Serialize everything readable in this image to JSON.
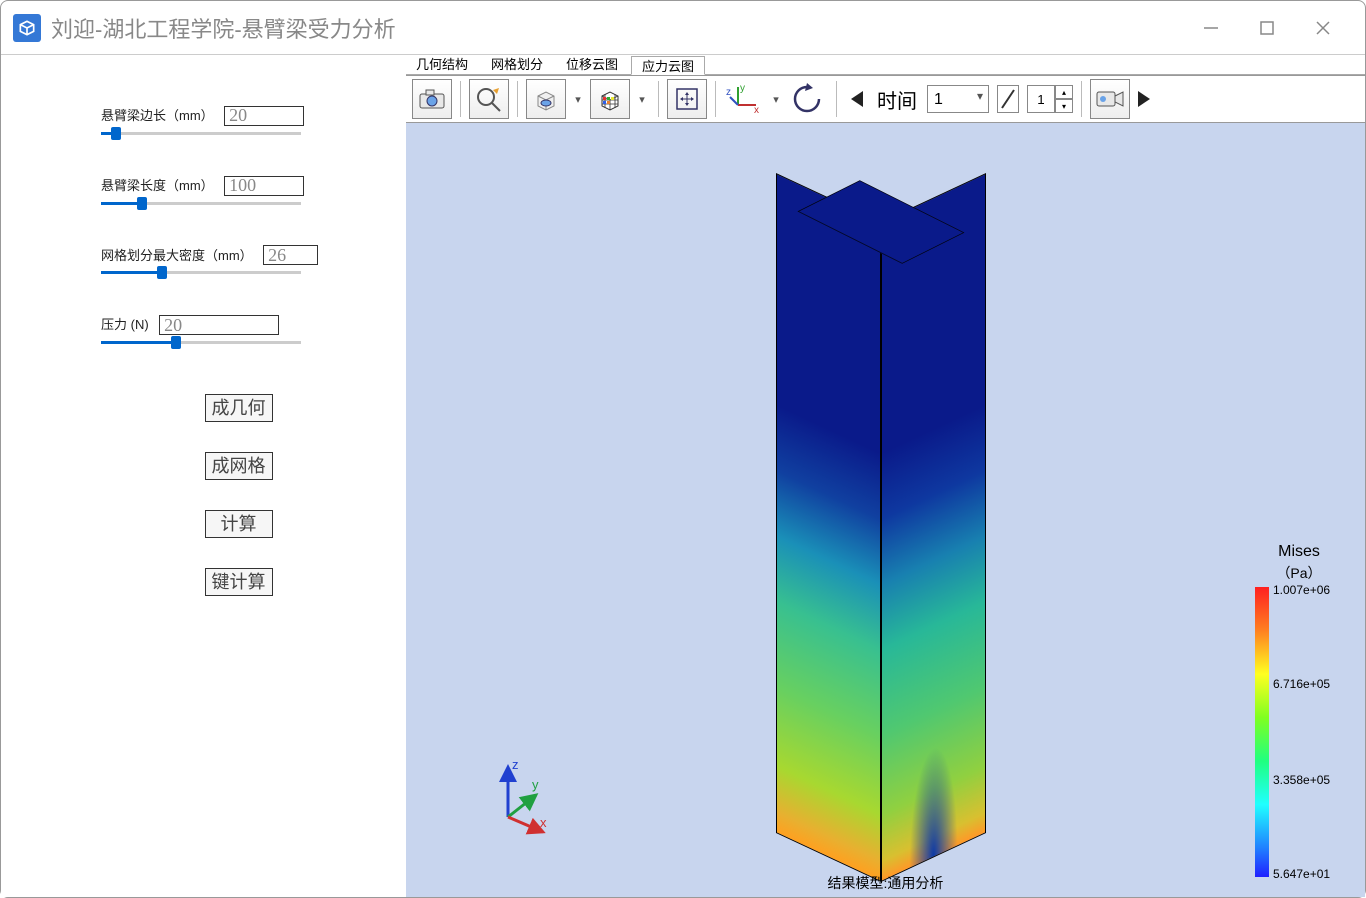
{
  "window": {
    "title": "刘迎-湖北工程学院-悬臂梁受力分析"
  },
  "sidebar": {
    "params": [
      {
        "label": "悬臂梁边长（mm）",
        "value": "20",
        "slider_pct": 5
      },
      {
        "label": "悬臂梁长度（mm）",
        "value": "100",
        "slider_pct": 18
      },
      {
        "label": "网格划分最大密度（mm）",
        "value": "26",
        "slider_pct": 28
      },
      {
        "label": "压力 (N)",
        "value": "20",
        "slider_pct": 35
      }
    ],
    "buttons": [
      "成几何",
      "成网格",
      "计算",
      "键计算"
    ]
  },
  "tabs": {
    "items": [
      "几何结构",
      "网格划分",
      "位移云图",
      "应力云图"
    ],
    "active_index": 3
  },
  "toolbar": {
    "time_label": "时间",
    "time_value": "1",
    "frame_value": "1"
  },
  "viewport": {
    "result_label": "结果模型:通用分析",
    "axes": {
      "x": "x",
      "y": "y",
      "z": "z"
    }
  },
  "legend": {
    "title": "Mises",
    "unit": "（Pa）",
    "ticks": [
      {
        "pos": 0,
        "label": "1.007e+06"
      },
      {
        "pos": 33,
        "label": "6.716e+05"
      },
      {
        "pos": 66,
        "label": "3.358e+05"
      },
      {
        "pos": 100,
        "label": "5.647e+01"
      }
    ]
  },
  "chart_data": {
    "type": "heatmap",
    "title": "Mises",
    "unit": "Pa",
    "colorbar": {
      "min": 56.47,
      "max": 1007000,
      "ticks": [
        1007000,
        671600,
        335800,
        56.47
      ]
    },
    "description": "Von Mises stress contour on a rectangular cantilever beam (20 mm × 20 mm × 100 mm). Fixed end at bottom shows peak stress ≈1.0e6 Pa transitioning through green/cyan mid-height to deep blue ≈5.6e1 Pa at the free top end.",
    "geometry": {
      "edge_mm": 20,
      "length_mm": 100,
      "mesh_max_mm": 26,
      "load_N": 20
    }
  }
}
